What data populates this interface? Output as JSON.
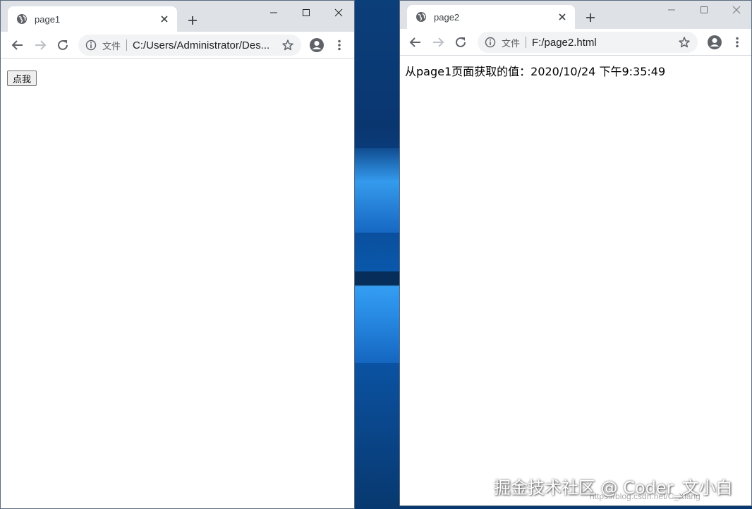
{
  "window1": {
    "tab": {
      "title": "page1"
    },
    "omnibox": {
      "scheme_label": "文件",
      "url": "C:/Users/Administrator/Des..."
    },
    "page": {
      "button_label": "点我"
    }
  },
  "window2": {
    "tab": {
      "title": "page2"
    },
    "omnibox": {
      "scheme_label": "文件",
      "url": "F:/page2.html"
    },
    "page": {
      "text": "从page1页面获取的值：2020/10/24 下午9:35:49"
    }
  },
  "watermark": {
    "text": "掘金技术社区 @ Coder_文小白",
    "subtext": "https://blog.csdn.net/C_Xiang"
  },
  "colors": {
    "tabstrip": "#dee1e6",
    "omnibox": "#f1f3f4",
    "icon": "#5f6368"
  },
  "icons": [
    "globe-icon",
    "close-icon",
    "plus-icon",
    "minimize-icon",
    "maximize-icon",
    "back-icon",
    "forward-icon",
    "reload-icon",
    "info-icon",
    "star-icon",
    "account-icon",
    "menu-icon"
  ]
}
